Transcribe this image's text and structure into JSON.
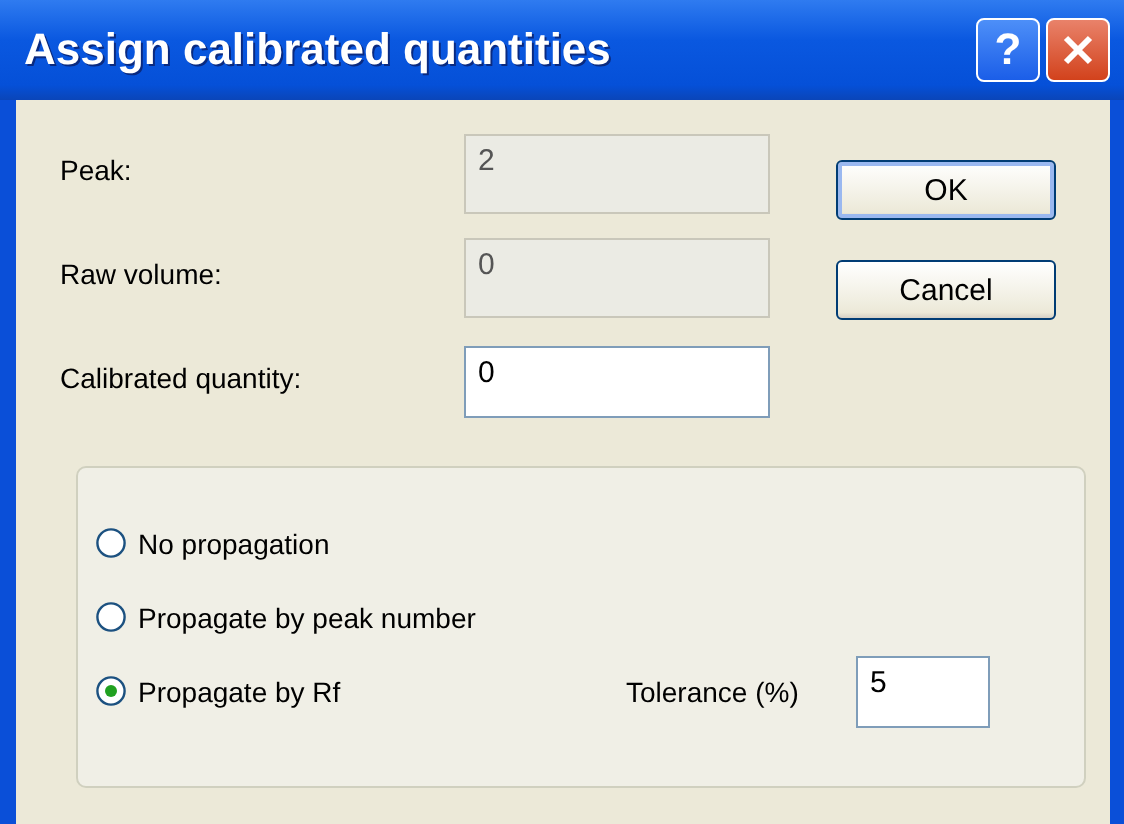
{
  "window": {
    "title": "Assign calibrated quantities",
    "help": "?"
  },
  "fields": [
    {
      "label": "Peak:",
      "value": "2",
      "disabled": true
    },
    {
      "label": "Raw volume:",
      "value": "0",
      "disabled": true
    },
    {
      "label": "Calibrated quantity:",
      "value": "0",
      "disabled": false
    }
  ],
  "buttons": [
    {
      "label": "OK",
      "default": true
    },
    {
      "label": "Cancel",
      "default": false
    }
  ],
  "propagation": {
    "options": [
      {
        "label": "No propagation",
        "selected": false
      },
      {
        "label": "Propagate by peak number",
        "selected": false
      },
      {
        "label": "Propagate by Rf",
        "selected": true
      }
    ],
    "tolerance": {
      "label": "Tolerance (%)",
      "value": "5"
    }
  }
}
